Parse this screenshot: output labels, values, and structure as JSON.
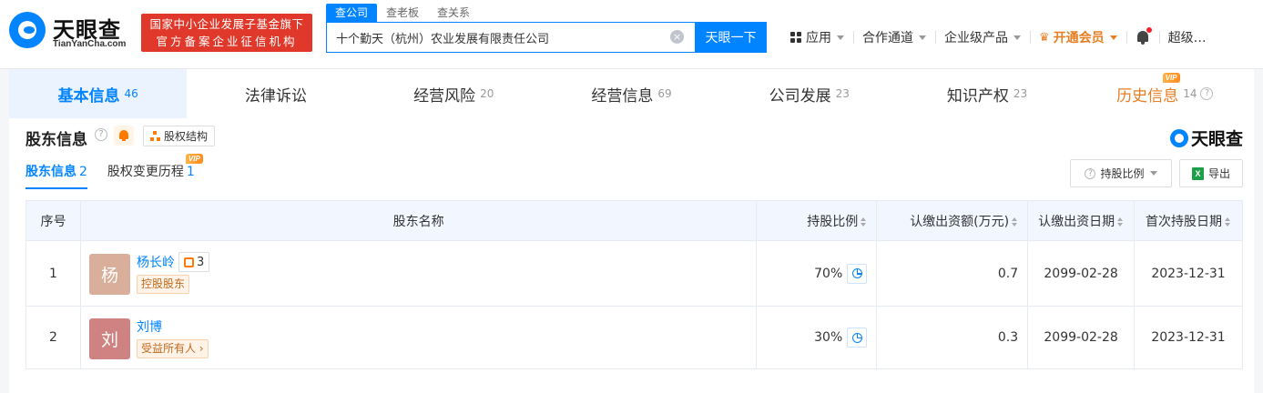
{
  "header": {
    "logo_name": "天眼查",
    "logo_domain": "TianYanCha.com",
    "gov_badge_line1": "国家中小企业发展子基金旗下",
    "gov_badge_line2": "官方备案企业征信机构",
    "search_tabs": [
      "查公司",
      "查老板",
      "查关系"
    ],
    "search_value": "十个勤天（杭州）农业发展有限责任公司",
    "search_clear": "×",
    "search_button": "天眼一下",
    "nav": {
      "apps": "应用",
      "cooperation": "合作通道",
      "enterprise": "企业级产品",
      "vip": "开通会员",
      "user": "超级…"
    }
  },
  "tabs": [
    {
      "label": "基本信息",
      "count": "46"
    },
    {
      "label": "法律诉讼",
      "count": ""
    },
    {
      "label": "经营风险",
      "count": "20"
    },
    {
      "label": "经营信息",
      "count": "69"
    },
    {
      "label": "公司发展",
      "count": "23"
    },
    {
      "label": "知识产权",
      "count": "23"
    },
    {
      "label": "历史信息",
      "count": "14",
      "vip": "VIP"
    }
  ],
  "section": {
    "title": "股东信息",
    "help": "?",
    "equity_button": "股权结构",
    "brand": "天眼查",
    "sub_tabs": [
      {
        "label": "股东信息",
        "count": "2"
      },
      {
        "label": "股权变更历程",
        "count": "1",
        "vip": "VIP"
      }
    ],
    "ratio_button": "持股比例",
    "export_button": "导出",
    "excel_letter": "X"
  },
  "table": {
    "headers": {
      "no": "序号",
      "name": "股东名称",
      "ratio": "持股比例",
      "capital": "认缴出资额(万元)",
      "date": "认缴出资日期",
      "first_date": "首次持股日期"
    },
    "rows": [
      {
        "no": "1",
        "avatar_char": "杨",
        "avatar_color": "#d9ae9a",
        "name": "杨长岭",
        "tree_count": "3",
        "tag": "控股股东",
        "ratio": "70%",
        "capital": "0.7",
        "date": "2099-02-28",
        "first_date": "2023-12-31"
      },
      {
        "no": "2",
        "avatar_char": "刘",
        "avatar_color": "#cf8282",
        "name": "刘博",
        "tag": "受益所有人",
        "ratio": "30%",
        "capital": "0.3",
        "date": "2099-02-28",
        "first_date": "2023-12-31"
      }
    ]
  },
  "colors": {
    "accent": "#0084ff",
    "gov_badge": "#e0392b",
    "vip": "#e67e22"
  },
  "icons": [
    "search-clear-icon",
    "grid-icon",
    "crown-icon",
    "bell-icon",
    "help-icon",
    "org-chart-icon",
    "pie-chart-icon",
    "excel-icon",
    "sort-icon"
  ]
}
